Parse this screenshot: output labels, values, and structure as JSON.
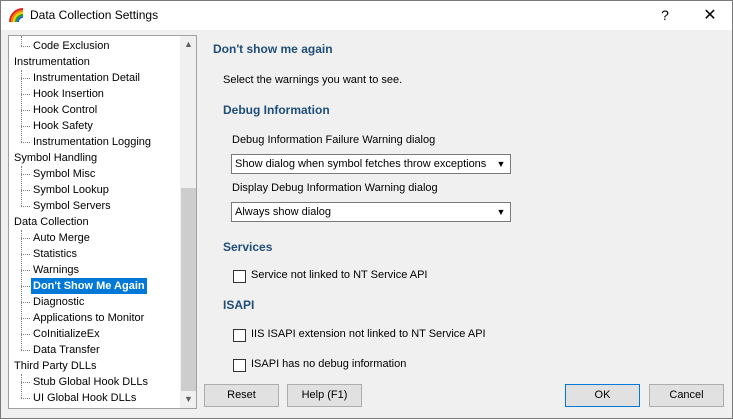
{
  "window": {
    "title": "Data Collection Settings",
    "help_glyph": "?",
    "close_glyph": "✕"
  },
  "tree": {
    "items": [
      {
        "label": "Code Exclusion",
        "level": 1
      },
      {
        "label": "Instrumentation",
        "level": 0
      },
      {
        "label": "Instrumentation Detail",
        "level": 1
      },
      {
        "label": "Hook Insertion",
        "level": 1
      },
      {
        "label": "Hook Control",
        "level": 1
      },
      {
        "label": "Hook Safety",
        "level": 1
      },
      {
        "label": "Instrumentation Logging",
        "level": 1
      },
      {
        "label": "Symbol Handling",
        "level": 0
      },
      {
        "label": "Symbol Misc",
        "level": 1
      },
      {
        "label": "Symbol Lookup",
        "level": 1
      },
      {
        "label": "Symbol Servers",
        "level": 1
      },
      {
        "label": "Data Collection",
        "level": 0
      },
      {
        "label": "Auto Merge",
        "level": 1
      },
      {
        "label": "Statistics",
        "level": 1
      },
      {
        "label": "Warnings",
        "level": 1
      },
      {
        "label": "Don't Show Me Again",
        "level": 1,
        "selected": true
      },
      {
        "label": "Diagnostic",
        "level": 1
      },
      {
        "label": "Applications to Monitor",
        "level": 1
      },
      {
        "label": "CoInitializeEx",
        "level": 1
      },
      {
        "label": "Data Transfer",
        "level": 1
      },
      {
        "label": "Third Party DLLs",
        "level": 0
      },
      {
        "label": "Stub Global Hook DLLs",
        "level": 1
      },
      {
        "label": "UI Global Hook DLLs",
        "level": 1
      }
    ]
  },
  "panel": {
    "title": "Don't show me again",
    "intro": "Select the warnings you want to see.",
    "debug": {
      "heading": "Debug Information",
      "failure_label": "Debug Information Failure Warning dialog",
      "failure_value": "Show dialog when symbol fetches throw exceptions",
      "display_label": "Display Debug Information Warning dialog",
      "display_value": "Always show dialog"
    },
    "services": {
      "heading": "Services",
      "check1": "Service not linked to NT Service API"
    },
    "isapi": {
      "heading": "ISAPI",
      "check1": "IIS ISAPI extension not linked to NT Service API",
      "check2": "ISAPI has no debug information"
    }
  },
  "buttons": {
    "reset": "Reset",
    "help": "Help (F1)",
    "ok": "OK",
    "cancel": "Cancel"
  }
}
